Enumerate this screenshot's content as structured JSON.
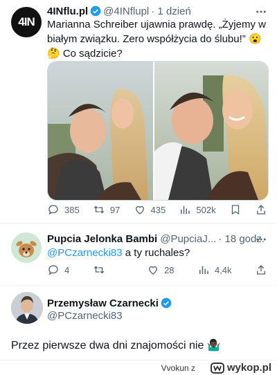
{
  "tweet1": {
    "avatar_text": "4IN",
    "name": "4INflu.pl",
    "handle": "@4INflupl",
    "time": "· 1 dzień",
    "text_line1": "Marianna Schreiber ujawnia prawdę. „Żyjemy w",
    "text_line2": "białym związku. Zero współżycia do ślubu!” 😮",
    "text_line3": "🤔 Co sądzicie?",
    "replies": "385",
    "retweets": "97",
    "likes": "435",
    "views": "502k"
  },
  "tweet2": {
    "name": "Pupcia Jelonka Bambi",
    "handle": "@PupciaJ...",
    "time": "· 18 godz.",
    "mention": "@PCzarnecki83",
    "text": " a ty ruchales?",
    "replies": "4",
    "retweets": "",
    "likes": "28",
    "views": "4,4k"
  },
  "tweet3": {
    "name": "Przemysław Czarnecki",
    "handle": "@PCzarnecki83",
    "text": "Przez pierwsze dwa dni znajomości nie 🤷🏿‍♂️"
  },
  "footer": {
    "user": "Vvokun z",
    "site": "wykop.pl"
  },
  "colors": {
    "accent": "#1d9bf0",
    "secondary_text": "#536471"
  }
}
